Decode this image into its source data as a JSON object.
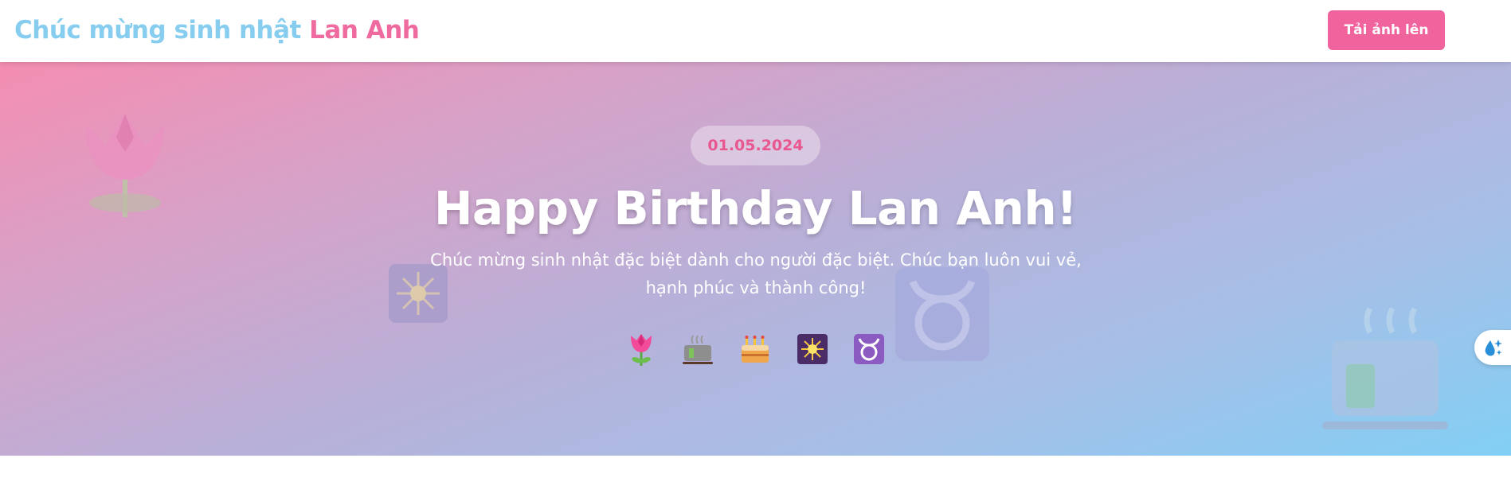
{
  "header": {
    "brand_prefix": "Chúc mừng sinh nhật",
    "brand_name": "Lan Anh",
    "upload_label": "Tải ảnh lên"
  },
  "hero": {
    "date": "01.05.2024",
    "title": "Happy Birthday Lan Anh!",
    "subtitle": "Chúc mừng sinh nhật đặc biệt dành cho người đặc biệt. Chúc bạn luôn vui vẻ, hạnh phúc và thành công!",
    "emojis": [
      "tulip",
      "hot-coffee",
      "birthday-cake",
      "sparkler",
      "taurus"
    ]
  },
  "colors": {
    "brand_blue": "#87cdf0",
    "brand_pink": "#ef6a9f",
    "button_pink": "#f0639c",
    "gradient_start": "#f48db1",
    "gradient_end": "#82cff5"
  },
  "floating_button": {
    "icon": "sparkle-droplet-icon"
  }
}
